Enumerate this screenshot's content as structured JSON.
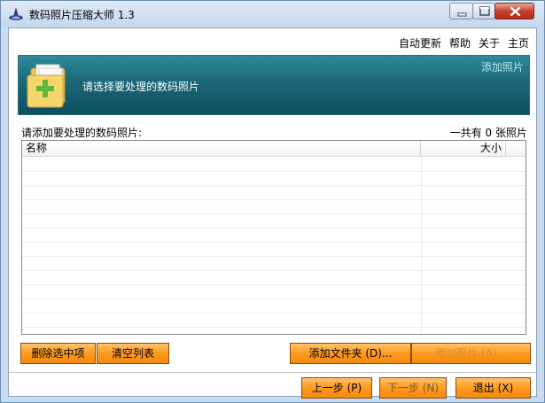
{
  "window": {
    "title": "数码照片压缩大师 1.3"
  },
  "menu": {
    "items": [
      "自动更新",
      "帮助",
      "关于",
      "主页"
    ]
  },
  "banner": {
    "instruction": "请选择要处理的数码照片",
    "add_photo_link": "添加照片",
    "icon": "folder-add-icon"
  },
  "list": {
    "label": "请添加要处理的数码照片:",
    "count_text": "一共有 0 张照片",
    "columns": [
      "名称",
      "大小"
    ],
    "rows": []
  },
  "buttons": {
    "delete_selected": "删除选中项",
    "clear_list": "清空列表",
    "add_folder": "添加文件夹 (D)...",
    "add_photo": "添加照片 (A)...",
    "prev": "上一步 (P)",
    "next": "下一步 (N)",
    "exit": "退出 (X)"
  },
  "colors": {
    "banner": "#1a6778",
    "button_orange": "#ff9a1e",
    "banner_link": "#b8e4ef"
  }
}
